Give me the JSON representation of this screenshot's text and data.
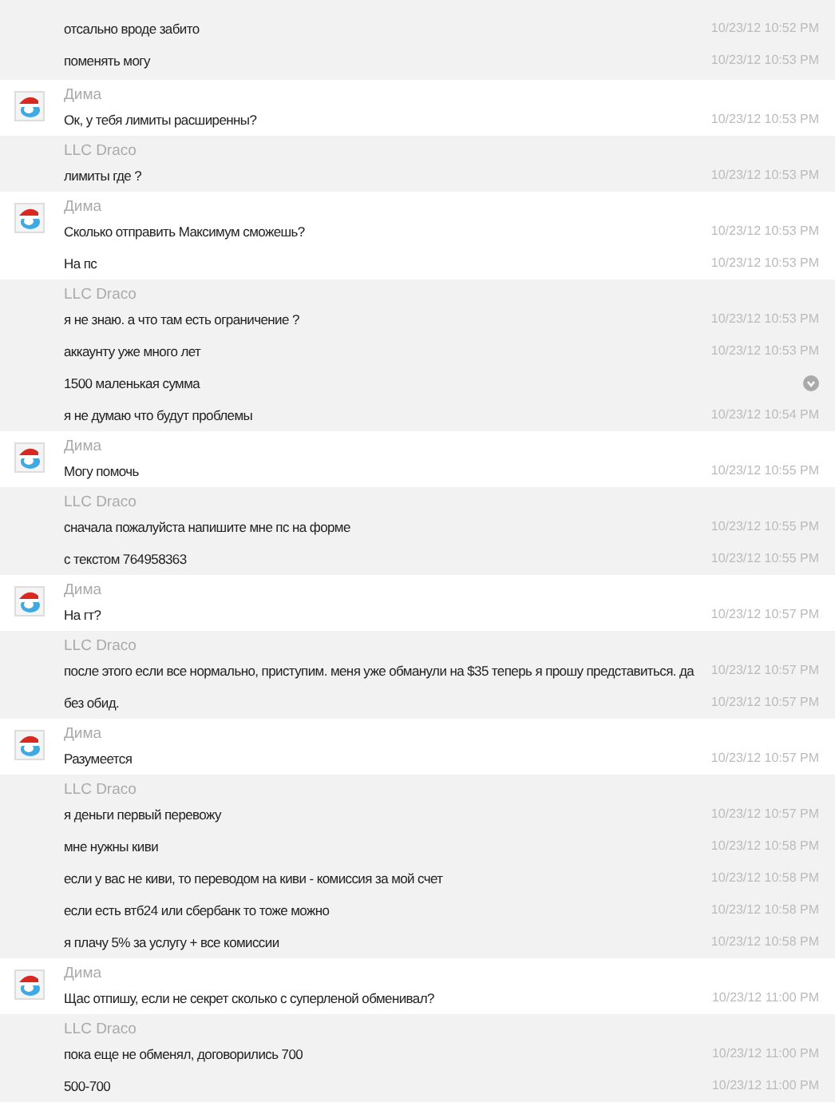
{
  "groups": [
    {
      "avatar": false,
      "messages": [
        {
          "text": "отсально вроде забито",
          "time": "10/23/12 10:52 PM",
          "error": false
        },
        {
          "text": "поменять могу",
          "time": "10/23/12 10:53 PM",
          "error": false
        }
      ]
    },
    {
      "sender": "Дима",
      "avatar": true,
      "messages": [
        {
          "text": "Ок, у тебя лимиты расширенны?",
          "time": "10/23/12 10:53 PM",
          "error": false
        }
      ]
    },
    {
      "sender": "LLC Draco",
      "avatar": false,
      "messages": [
        {
          "text": "лимиты где ?",
          "time": "10/23/12 10:53 PM",
          "error": false
        }
      ]
    },
    {
      "sender": "Дима",
      "avatar": true,
      "messages": [
        {
          "text": "Сколько отправить Максимум сможешь?",
          "time": "10/23/12 10:53 PM",
          "error": false
        },
        {
          "text": "На пс",
          "time": "10/23/12 10:53 PM",
          "error": false
        }
      ]
    },
    {
      "sender": "LLC Draco",
      "avatar": false,
      "messages": [
        {
          "text": "я не знаю. а что там есть ограничение ?",
          "time": "10/23/12 10:53 PM",
          "error": false
        },
        {
          "text": "аккаунту уже много лет",
          "time": "10/23/12 10:53 PM",
          "error": false
        },
        {
          "text": "1500 маленькая сумма",
          "error": true
        },
        {
          "text": "я не думаю что будут проблемы",
          "time": "10/23/12 10:54 PM",
          "error": false
        }
      ]
    },
    {
      "sender": "Дима",
      "avatar": true,
      "messages": [
        {
          "text": "Могу помочь",
          "time": "10/23/12 10:55 PM",
          "error": false
        }
      ]
    },
    {
      "sender": "LLC Draco",
      "avatar": false,
      "messages": [
        {
          "text": "сначала пожалуйста напишите мне пс на форме",
          "time": "10/23/12 10:55 PM",
          "error": false
        },
        {
          "text": "с текстом 764958363",
          "time": "10/23/12 10:55 PM",
          "error": false
        }
      ]
    },
    {
      "sender": "Дима",
      "avatar": true,
      "messages": [
        {
          "text": "На гт?",
          "time": "10/23/12 10:57 PM",
          "error": false
        }
      ]
    },
    {
      "sender": "LLC Draco",
      "avatar": false,
      "messages": [
        {
          "text": "после этого если все нормально, приступим. меня уже обманули на $35 теперь я прошу представиться. да",
          "time": "10/23/12 10:57 PM",
          "error": false
        },
        {
          "text": "без обид.",
          "time": "10/23/12 10:57 PM",
          "error": false
        }
      ]
    },
    {
      "sender": "Дима",
      "avatar": true,
      "messages": [
        {
          "text": "Разумеется",
          "time": "10/23/12 10:57 PM",
          "error": false
        }
      ]
    },
    {
      "sender": "LLC Draco",
      "avatar": false,
      "messages": [
        {
          "text": "я деньги первый перевожу",
          "time": "10/23/12 10:57 PM",
          "error": false
        },
        {
          "text": "мне нужны киви",
          "time": "10/23/12 10:58 PM",
          "error": false
        },
        {
          "text": "если у вас не киви, то переводом на киви - комиссия за мой счет",
          "time": "10/23/12 10:58 PM",
          "error": false
        },
        {
          "text": "если есть втб24 или сбербанк то тоже можно",
          "time": "10/23/12 10:58 PM",
          "error": false
        },
        {
          "text": "я плачу 5% за услугу + все комиссии",
          "time": "10/23/12 10:58 PM",
          "error": false
        }
      ]
    },
    {
      "sender": "Дима",
      "avatar": true,
      "messages": [
        {
          "text": "Щас отпишу, если не секрет сколько с суперленой обменивал?",
          "time": "10/23/12 11:00 PM",
          "error": false
        }
      ]
    },
    {
      "sender": "LLC Draco",
      "avatar": false,
      "messages": [
        {
          "text": "пока еще не обменял, договорились 700",
          "time": "10/23/12 11:00 PM",
          "error": false
        },
        {
          "text": "500-700",
          "time": "10/23/12 11:00 PM",
          "error": false
        }
      ]
    }
  ]
}
